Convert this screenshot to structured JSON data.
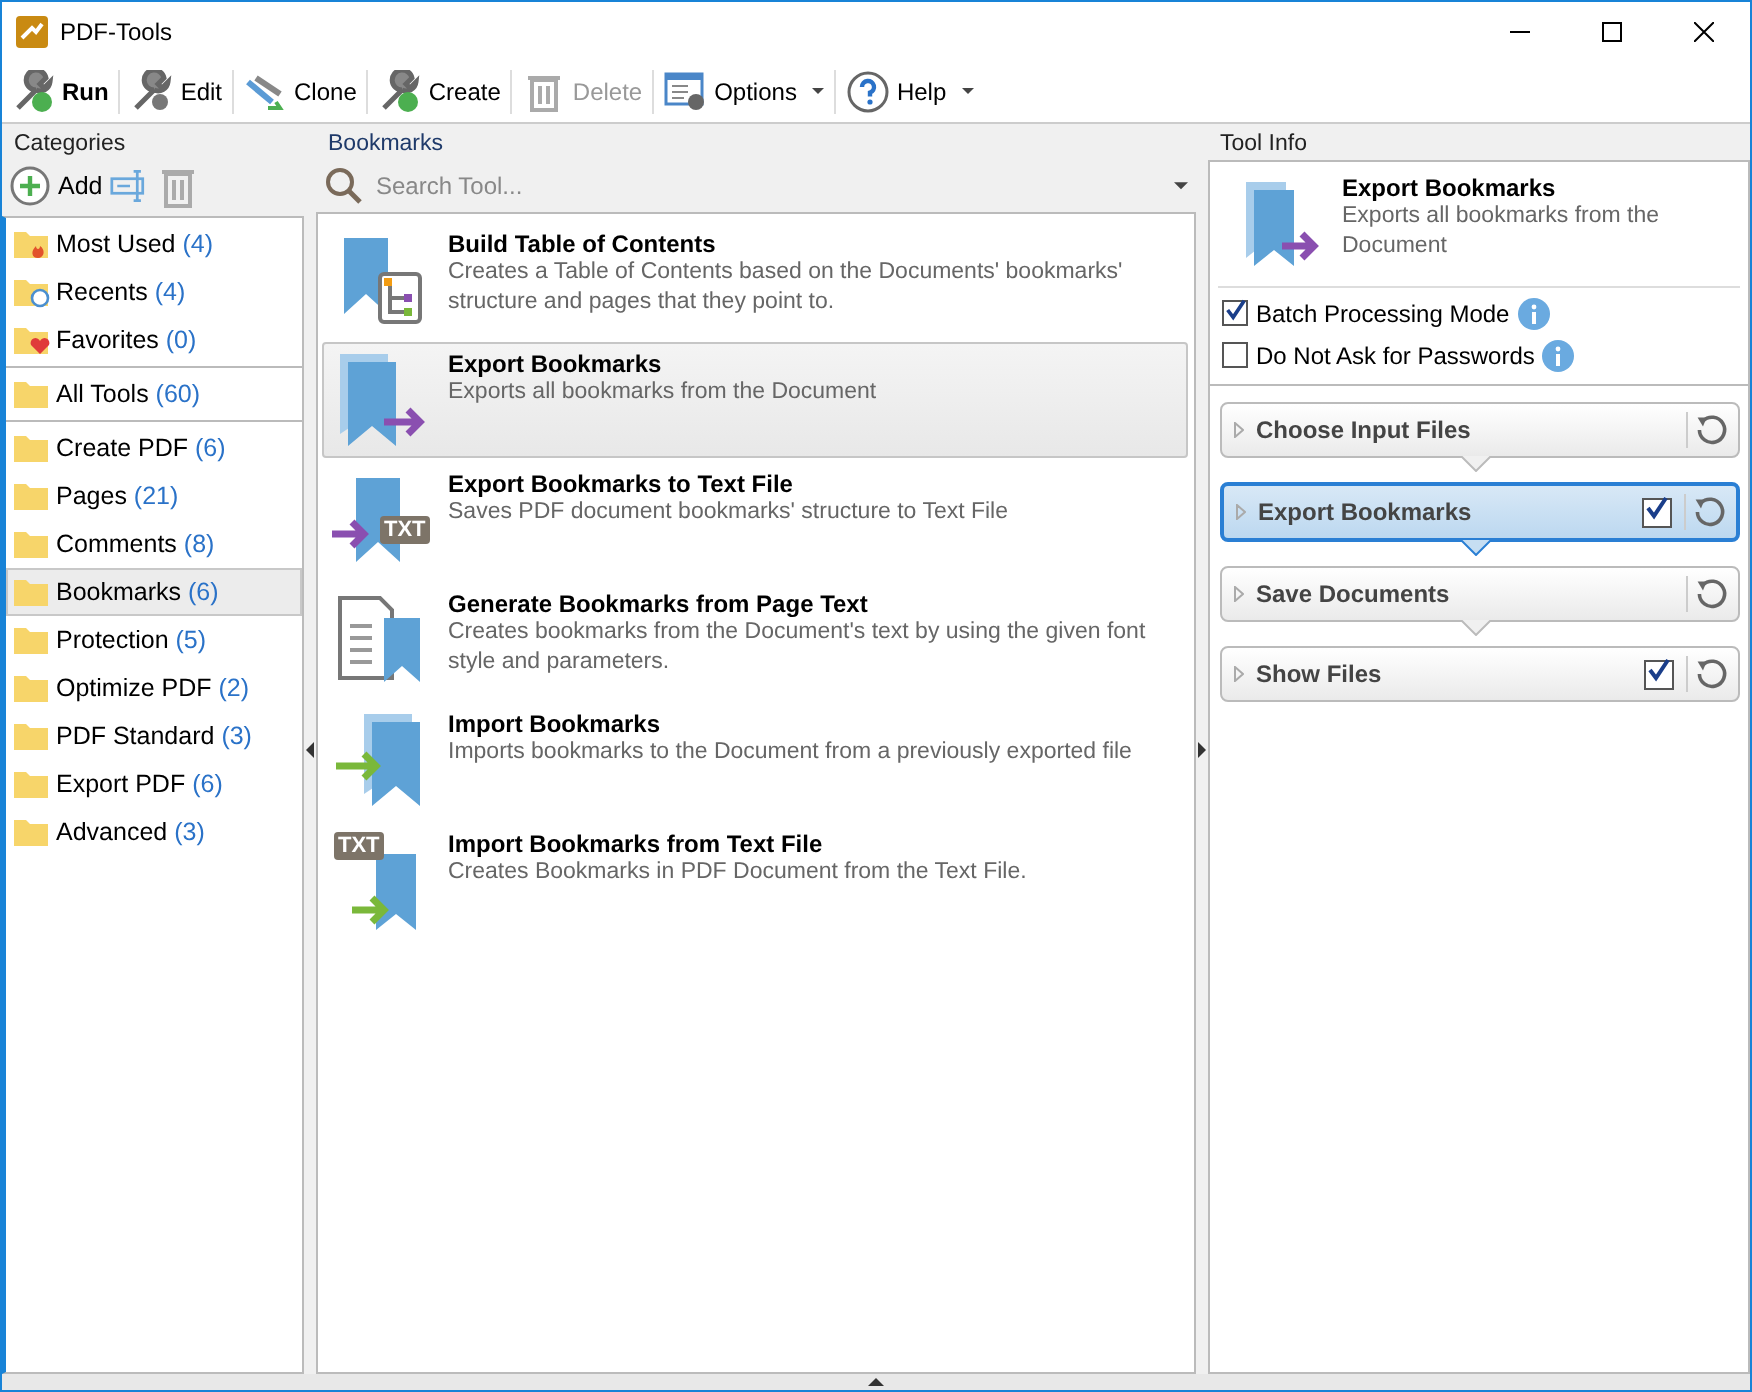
{
  "window": {
    "title": "PDF-Tools"
  },
  "toolbar": [
    {
      "kind": "run",
      "label": "Run",
      "disabled": false,
      "dropdown": false
    },
    {
      "kind": "edit",
      "label": "Edit",
      "disabled": false,
      "dropdown": false
    },
    {
      "kind": "clone",
      "label": "Clone",
      "disabled": false,
      "dropdown": false
    },
    {
      "kind": "create",
      "label": "Create",
      "disabled": false,
      "dropdown": false
    },
    {
      "kind": "delete",
      "label": "Delete",
      "disabled": true,
      "dropdown": false
    },
    {
      "kind": "options",
      "label": "Options",
      "disabled": false,
      "dropdown": true
    },
    {
      "kind": "help",
      "label": "Help",
      "disabled": false,
      "dropdown": true
    }
  ],
  "categories": {
    "title": "Categories",
    "add_label": "Add",
    "groups": [
      [
        {
          "kind": "fire",
          "label": "Most Used",
          "count": "(4)",
          "selected": false
        },
        {
          "kind": "clock",
          "label": "Recents",
          "count": "(4)",
          "selected": false
        },
        {
          "kind": "heart",
          "label": "Favorites",
          "count": "(0)",
          "selected": false
        }
      ],
      [
        {
          "kind": "plain",
          "label": "All Tools",
          "count": "(60)",
          "selected": false
        }
      ],
      [
        {
          "kind": "plain",
          "label": "Create PDF",
          "count": "(6)",
          "selected": false
        },
        {
          "kind": "plain",
          "label": "Pages",
          "count": "(21)",
          "selected": false
        },
        {
          "kind": "plain",
          "label": "Comments",
          "count": "(8)",
          "selected": false
        },
        {
          "kind": "plain",
          "label": "Bookmarks",
          "count": "(6)",
          "selected": true
        },
        {
          "kind": "plain",
          "label": "Protection",
          "count": "(5)",
          "selected": false
        },
        {
          "kind": "plain",
          "label": "Optimize PDF",
          "count": "(2)",
          "selected": false
        },
        {
          "kind": "plain",
          "label": "PDF Standard",
          "count": "(3)",
          "selected": false
        },
        {
          "kind": "plain",
          "label": "Export PDF",
          "count": "(6)",
          "selected": false
        },
        {
          "kind": "plain",
          "label": "Advanced",
          "count": "(3)",
          "selected": false
        }
      ]
    ]
  },
  "tools": {
    "title": "Bookmarks",
    "search": {
      "placeholder": "Search Tool..."
    },
    "items": [
      {
        "kind": "toc",
        "title": "Build Table of Contents",
        "description": "Creates a Table of Contents based on the Documents' bookmarks' structure and pages that they point to.",
        "selected": false
      },
      {
        "kind": "export",
        "title": "Export Bookmarks",
        "description": "Exports all bookmarks from the Document",
        "selected": true
      },
      {
        "kind": "export_txt",
        "badge": "TXT",
        "title": "Export Bookmarks to Text File",
        "description": "Saves PDF document bookmarks' structure to Text File",
        "selected": false
      },
      {
        "kind": "generate",
        "title": "Generate Bookmarks from Page Text",
        "description": "Creates bookmarks from the Document's text by using the given font style and parameters.",
        "selected": false
      },
      {
        "kind": "import",
        "title": "Import Bookmarks",
        "description": "Imports bookmarks to the Document from a previously exported file",
        "selected": false
      },
      {
        "kind": "import_txt",
        "badge": "TXT",
        "title": "Import Bookmarks from Text File",
        "description": "Creates Bookmarks in PDF Document from the Text File.",
        "selected": false
      }
    ]
  },
  "tool_info": {
    "title": "Tool Info",
    "tool_title": "Export Bookmarks",
    "tool_description": "Exports all bookmarks from the Document",
    "options": [
      {
        "label": "Batch Processing Mode",
        "checked": true
      },
      {
        "label": "Do Not Ask for Passwords",
        "checked": false
      }
    ],
    "steps": [
      {
        "label": "Choose Input Files",
        "selected": false,
        "has_checkbox": false
      },
      {
        "label": "Export Bookmarks",
        "selected": true,
        "has_checkbox": true,
        "checked": true
      },
      {
        "label": "Save Documents",
        "selected": false,
        "has_checkbox": false
      },
      {
        "label": "Show Files",
        "selected": false,
        "has_checkbox": true,
        "checked": true
      }
    ]
  }
}
